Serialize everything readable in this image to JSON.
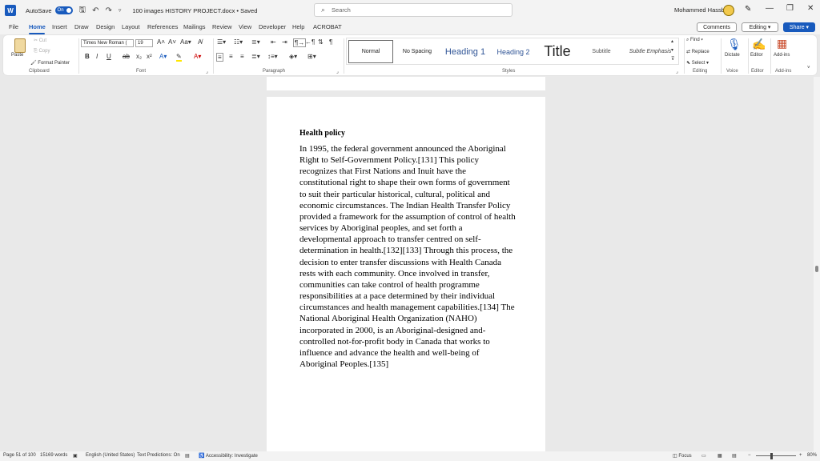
{
  "titlebar": {
    "autosave_label": "AutoSave",
    "autosave_state": "On",
    "document_name": "100 images HISTORY PROJECT.docx • Saved",
    "search_placeholder": "Search",
    "user_name": "Mohammed Hassbo"
  },
  "menu": {
    "items": [
      "File",
      "Home",
      "Insert",
      "Draw",
      "Design",
      "Layout",
      "References",
      "Mailings",
      "Review",
      "View",
      "Developer",
      "Help",
      "ACROBAT"
    ],
    "active": "Home",
    "comments_label": "Comments",
    "editing_label": "Editing",
    "share_label": "Share"
  },
  "ribbon": {
    "clipboard": {
      "paste": "Paste",
      "cut": "Cut",
      "copy": "Copy",
      "format_painter": "Format Painter",
      "label": "Clipboard"
    },
    "font": {
      "name": "Times New Roman (",
      "size": "19",
      "label": "Font"
    },
    "paragraph": {
      "label": "Paragraph"
    },
    "styles": {
      "items": [
        "Normal",
        "No Spacing",
        "Heading 1",
        "Heading 2",
        "Title",
        "Subtitle",
        "Subtle Emphasis"
      ],
      "selected": "Normal",
      "label": "Styles"
    },
    "editing": {
      "find": "Find",
      "replace": "Replace",
      "select": "Select",
      "label": "Editing"
    },
    "voice": {
      "dictate": "Dictate",
      "label": "Voice"
    },
    "editor": {
      "editor": "Editor",
      "label": "Editor"
    },
    "addins": {
      "addins": "Add-ins",
      "label": "Add-ins"
    }
  },
  "document": {
    "heading": "Health policy",
    "paragraph": "In 1995, the federal government announced the Aboriginal Right to Self-Government Policy.[131] This policy recognizes that First Nations and Inuit have the constitutional right to shape their own forms of government to suit their particular historical, cultural, political and economic circumstances. The Indian Health Transfer Policy provided a framework for the assumption of control of health services by Aboriginal peoples, and set forth a developmental approach to transfer centred on self-determination in health.[132][133] Through this process, the decision to enter transfer discussions with Health Canada rests with each community. Once involved in transfer, communities can take control of health programme responsibilities at a pace determined by their individual circumstances and health management capabilities.[134] The National Aboriginal Health Organization (NAHO) incorporated in 2000, is an Aboriginal-designed and-controlled not-for-profit body in Canada that works to influence and advance the health and well-being of Aboriginal Peoples.[135]"
  },
  "statusbar": {
    "page": "Page 51 of 100",
    "words": "15169 words",
    "language": "English (United States)",
    "predictions": "Text Predictions: On",
    "accessibility": "Accessibility: Investigate",
    "focus": "Focus",
    "zoom": "80%"
  },
  "colors": {
    "accent": "#185abd",
    "chrome": "#f3f3f3",
    "canvas": "#e9e9e9"
  }
}
